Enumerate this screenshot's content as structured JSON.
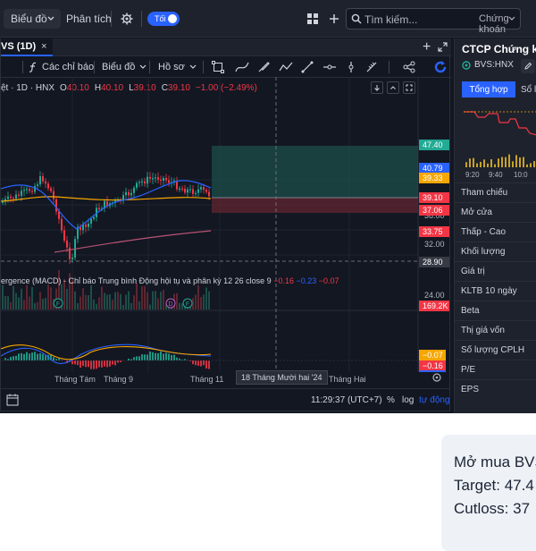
{
  "topbar": {
    "chart_menu": "Biểu đồ",
    "analysis_menu": "Phân tích",
    "theme_toggle": "Tối",
    "search_placeholder": "Tìm kiếm...",
    "search_category": "Chứng khoán"
  },
  "chart_tab": {
    "label": "VS (1D)",
    "close": "×"
  },
  "chart_toolbar": {
    "indicators": "Các chỉ báo",
    "chart_type": "Biểu đồ",
    "profile": "Hồ sơ"
  },
  "symbol_line": {
    "label": "ệt · 1D · HNX",
    "open_k": "O",
    "open_v": "40.10",
    "high_k": "H",
    "high_v": "40.10",
    "low_k": "L",
    "low_v": "39.10",
    "close_k": "C",
    "close_v": "39.10",
    "change": "−1.00 (−2.49%)"
  },
  "price_axis": {
    "labels": [
      "36.00",
      "32.00",
      "24.00"
    ],
    "tags": [
      {
        "text": "47.40",
        "color": "#22ab94"
      },
      {
        "text": "40.79",
        "color": "#2962ff"
      },
      {
        "text": "39.33",
        "color": "#f7a600"
      },
      {
        "text": "39.10",
        "color": "#f23645"
      },
      {
        "text": "37.06",
        "color": "#f23645"
      },
      {
        "text": "33.75",
        "color": "#f23645"
      },
      {
        "text": "28.90",
        "color": "#363a45"
      },
      {
        "text": "169.2K",
        "color": "#f23645"
      }
    ]
  },
  "event_markers": [
    "F",
    "D",
    "F"
  ],
  "macd": {
    "title": "ergence (MACD) - Chỉ báo Trung bình Động hội tụ và phân kỳ  12 26 close 9",
    "v1": "−0.16",
    "v2": "−0.23",
    "v3": "−0.07",
    "tags": [
      {
        "text": "−0.07",
        "color": "#f7a600"
      },
      {
        "text": "−0.16",
        "color": "#f23645"
      },
      {
        "text": "−0.23",
        "color": "#2962ff"
      }
    ]
  },
  "time_axis": {
    "labels": [
      "Tháng Tám",
      "Tháng 9",
      "Tháng 11",
      "Tháng Hai"
    ],
    "crosshair": "18 Tháng Mười hai '24"
  },
  "footer": {
    "clock": "11:29:37 (UTC+7)",
    "percent": "%",
    "log": "log",
    "auto": "tự động"
  },
  "right_panel": {
    "title": "CTCP Chứng kho",
    "symbol": "BVS:HNX",
    "tab_overview": "Tổng hợp",
    "tab_orderbook": "Sổ l",
    "mini_times": [
      "9:20",
      "9:40",
      "10:0"
    ],
    "rows": [
      "Tham chiếu",
      "Mở cửa",
      "Thấp - Cao",
      "Khối lượng",
      "Giá trị",
      "KLTB 10 ngày",
      "Beta",
      "Thị giá vốn",
      "Số lượng CPLH",
      "P/E",
      "EPS"
    ]
  },
  "note": {
    "line1": "Mở mua BVS",
    "line2": "Target: 47.4",
    "line3": "Cutloss: 37"
  },
  "colors": {
    "up": "#22ab94",
    "down": "#f23645",
    "accent": "#2962ff",
    "background": "#131722"
  }
}
